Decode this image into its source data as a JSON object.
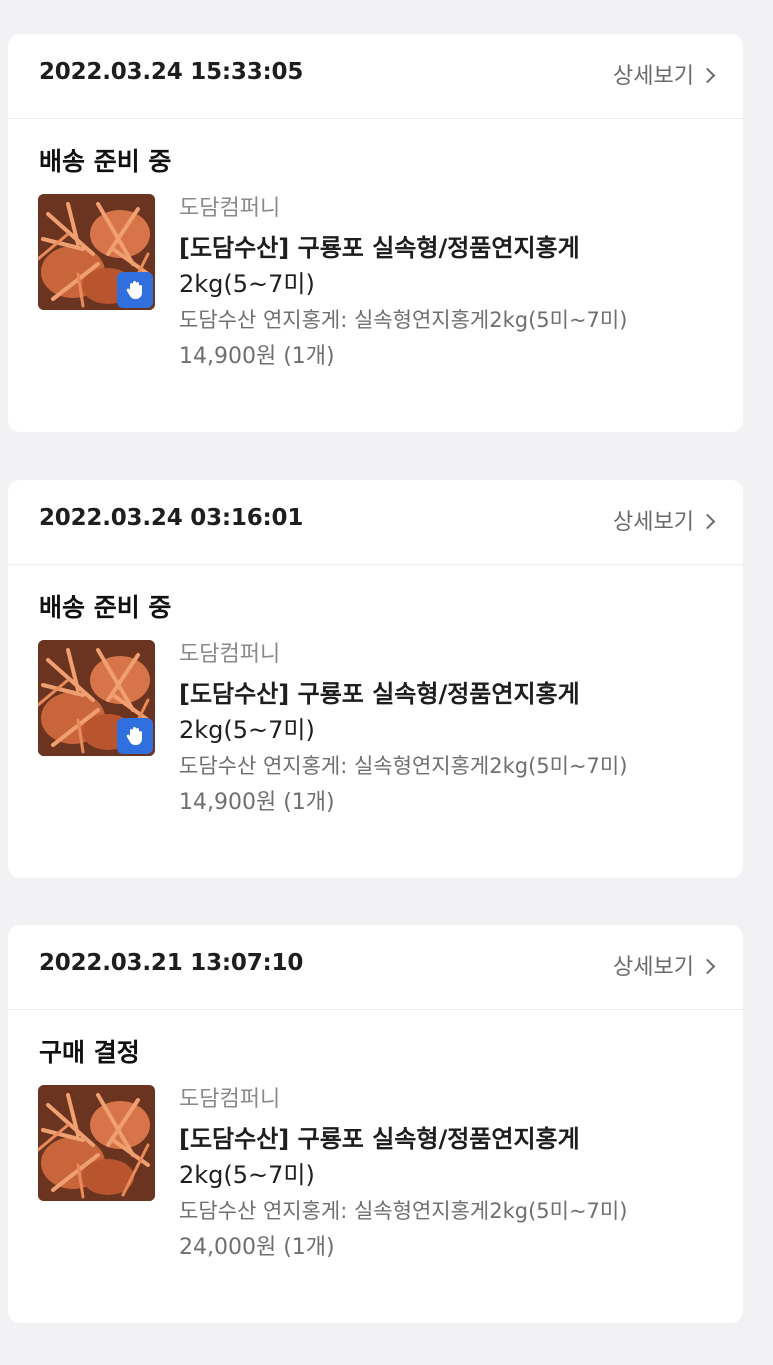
{
  "orders": [
    {
      "date": "2022.03.24 15:33:05",
      "detail_label": "상세보기",
      "status": "배송 준비 중",
      "seller": "도담컴퍼니",
      "product_name_bold": "[도담수산] 구룡포 실속형/정품연지홍게",
      "product_name_rest": " 2kg(5~7미)",
      "option": "도담수산 연지홍게: 실속형연지홍게2kg(5미~7미)",
      "price": "14,900원 (1개)",
      "has_badge": true
    },
    {
      "date": "2022.03.24 03:16:01",
      "detail_label": "상세보기",
      "status": "배송 준비 중",
      "seller": "도담컴퍼니",
      "product_name_bold": "[도담수산] 구룡포 실속형/정품연지홍게",
      "product_name_rest": " 2kg(5~7미)",
      "option": "도담수산 연지홍게: 실속형연지홍게2kg(5미~7미)",
      "price": "14,900원 (1개)",
      "has_badge": true
    },
    {
      "date": "2022.03.21 13:07:10",
      "detail_label": "상세보기",
      "status": "구매 결정",
      "seller": "도담컴퍼니",
      "product_name_bold": "[도담수산] 구룡포 실속형/정품연지홍게",
      "product_name_rest": " 2kg(5~7미)",
      "option": "도담수산 연지홍게: 실속형연지홍게2kg(5미~7미)",
      "price": "24,000원 (1개)",
      "has_badge": false
    }
  ],
  "colors": {
    "background": "#f2f2f4",
    "card": "#ffffff",
    "badge": "#2f6fde"
  },
  "icons": {
    "thumbnail": "crab-photo",
    "badge": "hand-wave-icon",
    "link_arrow": "chevron-right-icon"
  }
}
